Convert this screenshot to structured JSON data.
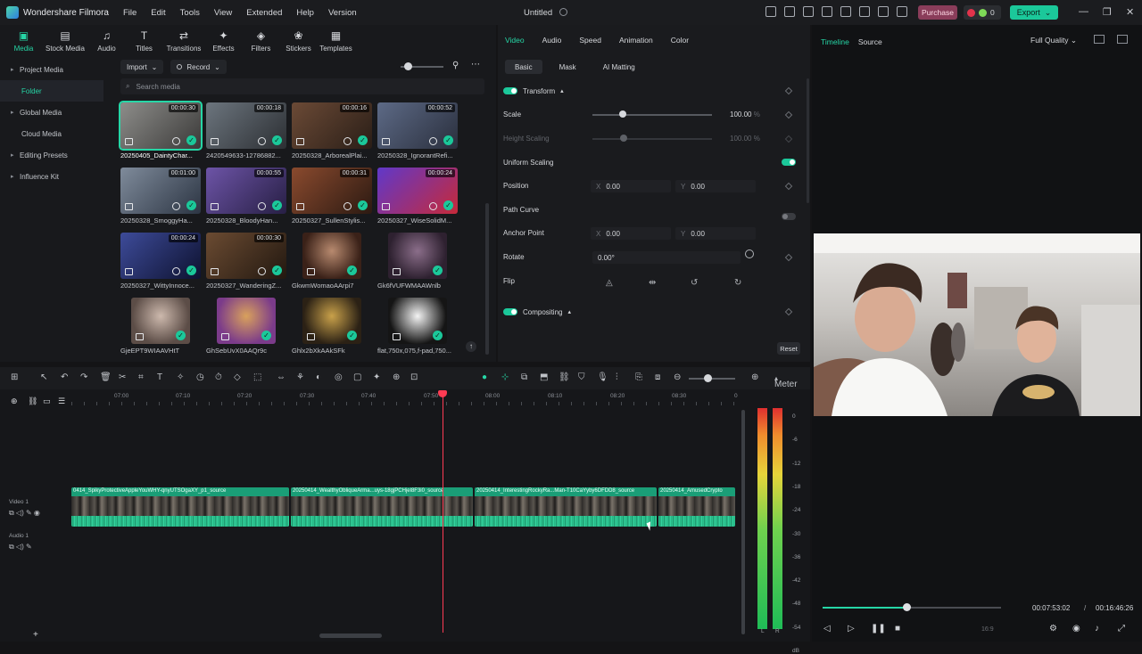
{
  "app": {
    "name": "Wondershare Filmora",
    "doc_title": "Untitled"
  },
  "menu": [
    "File",
    "Edit",
    "Tools",
    "View",
    "Extended",
    "Help",
    "Version"
  ],
  "topbar": {
    "purchase": "Purchase",
    "credits": "0",
    "export": "Export"
  },
  "media_tabs": [
    {
      "label": "Media",
      "icon": "▣"
    },
    {
      "label": "Stock Media",
      "icon": "▤"
    },
    {
      "label": "Audio",
      "icon": "♫"
    },
    {
      "label": "Titles",
      "icon": "T"
    },
    {
      "label": "Transitions",
      "icon": "⇄"
    },
    {
      "label": "Effects",
      "icon": "✦"
    },
    {
      "label": "Filters",
      "icon": "◈"
    },
    {
      "label": "Stickers",
      "icon": "❀"
    },
    {
      "label": "Templates",
      "icon": "▦"
    }
  ],
  "sidebar": [
    {
      "label": "Project Media",
      "caret": "▸"
    },
    {
      "label": "Folder",
      "caret": ""
    },
    {
      "label": "Global Media",
      "caret": "▸"
    },
    {
      "label": "Cloud Media",
      "caret": ""
    },
    {
      "label": "Editing Presets",
      "caret": "▸"
    },
    {
      "label": "Influence Kit",
      "caret": "▸"
    }
  ],
  "media_toolbar": {
    "import": "Import",
    "record": "Record",
    "search_placeholder": "Search media"
  },
  "media_items": [
    {
      "name": "20250405_DaintyChar...",
      "duration": "00:00:30",
      "colors": [
        "#8d8d8a",
        "#3b3a39"
      ]
    },
    {
      "name": "2420549633-12786882...",
      "duration": "00:00:18",
      "colors": [
        "#6c757e",
        "#2c2f33"
      ]
    },
    {
      "name": "20250328_ArborealPlai...",
      "duration": "00:00:16",
      "colors": [
        "#6b4a36",
        "#2a1e17"
      ]
    },
    {
      "name": "20250328_IgnorantRefi...",
      "duration": "00:00:52",
      "colors": [
        "#5d6a86",
        "#2a2f3d"
      ]
    },
    {
      "name": "20250328_SmoggyHa...",
      "duration": "00:01:00",
      "colors": [
        "#7f8b9b",
        "#2c3543"
      ]
    },
    {
      "name": "20250328_BloodyHan...",
      "duration": "00:00:55",
      "colors": [
        "#6d54a7",
        "#271f44"
      ]
    },
    {
      "name": "20250327_SullenStylis...",
      "duration": "00:00:31",
      "colors": [
        "#8a4a2e",
        "#2c1a12"
      ]
    },
    {
      "name": "20250327_WiseSolidM...",
      "duration": "00:00:24",
      "colors": [
        "#6038c9",
        "#c62a3a"
      ]
    },
    {
      "name": "20250327_WittyInnoce...",
      "duration": "00:00:24",
      "colors": [
        "#3d4b99",
        "#0e1230"
      ]
    },
    {
      "name": "20250327_WanderingZ...",
      "duration": "00:00:30",
      "colors": [
        "#6b4b32",
        "#221810"
      ]
    },
    {
      "name": "GkwmWomaoAArpi7",
      "duration": "",
      "colors": [
        "#b88a6f",
        "#3a2118"
      ]
    },
    {
      "name": "Gk6fVUFWMAAWnlb",
      "duration": "",
      "colors": [
        "#8b6e8a",
        "#2e2130"
      ]
    },
    {
      "name": "GjeEPT9WIAAVHtT",
      "duration": "",
      "colors": [
        "#cdb9ad",
        "#5c4d47"
      ]
    },
    {
      "name": "GhSebUvX0AAQr9c",
      "duration": "",
      "colors": [
        "#d9a15c",
        "#7b3b8a"
      ]
    },
    {
      "name": "Ghlx2bXkAAkSFk",
      "duration": "",
      "colors": [
        "#c9a14a",
        "#2b2115"
      ]
    },
    {
      "name": "flat,750x,075,f-pad,750...",
      "duration": "",
      "colors": [
        "#f4f4f4",
        "#151515"
      ]
    }
  ],
  "props": {
    "tabs": [
      "Video",
      "Audio",
      "Speed",
      "Animation",
      "Color"
    ],
    "subtabs": [
      "Basic",
      "Mask",
      "AI Matting"
    ],
    "transform": "Transform",
    "scale": {
      "label": "Scale",
      "value": "100.00",
      "unit": "%",
      "level": 0.25
    },
    "height_scaling": {
      "label": "Height Scaling",
      "value": "100.00",
      "unit": "%"
    },
    "uniform_scaling": "Uniform Scaling",
    "position": {
      "label": "Position",
      "x_label": "X",
      "x": "0.00",
      "y_label": "Y",
      "y": "0.00"
    },
    "path_curve": "Path Curve",
    "anchor": {
      "label": "Anchor Point",
      "x_label": "X",
      "x": "0.00",
      "y_label": "Y",
      "y": "0.00"
    },
    "rotate": {
      "label": "Rotate",
      "value": "0.00°"
    },
    "flip": "Flip",
    "compositing": "Compositing",
    "reset": "Reset"
  },
  "preview": {
    "tab_timeline": "Timeline",
    "tab_source": "Source",
    "quality": "Full Quality",
    "current": "00:07:53:02",
    "separator": "/",
    "total": "00:16:46:26",
    "ratio": "16:9",
    "progress": 0.47
  },
  "timeline": {
    "meter": "Meter",
    "ruler": [
      "07:00",
      "07:10",
      "07:20",
      "07:30",
      "07:40",
      "07:50",
      "08:00",
      "08:10",
      "08:20",
      "08:30",
      "0"
    ],
    "video_track": "Video 1",
    "audio_track": "Audio 1",
    "clips": [
      {
        "title": "0414_SpikyProtectiveAppleYouWHY-qnyUTSOgaXY_p1_source",
        "w": 246
      },
      {
        "title": "20250414_WealthyObliqueArma...uys-18gjPCHjel8F3i0_source",
        "w": 206
      },
      {
        "title": "20250414_InterestingRockyRa...Man-T10CaYyby6DFDD8_source",
        "w": 206
      },
      {
        "title": "20250414_AmusedCrypto",
        "w": 88
      }
    ],
    "meter_scale": [
      "0",
      "-6",
      "-12",
      "-18",
      "-24",
      "-30",
      "-36",
      "-42",
      "-48",
      "-54",
      "dB"
    ],
    "channels": [
      "L",
      "R"
    ]
  }
}
